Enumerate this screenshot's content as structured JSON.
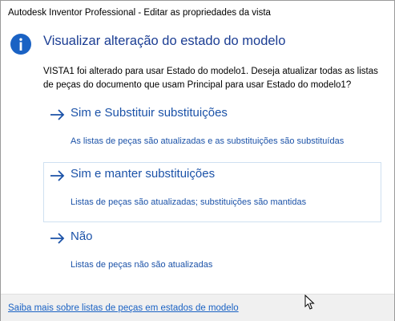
{
  "window": {
    "title": "Autodesk Inventor Professional - Editar as propriedades da vista"
  },
  "icon": {
    "name": "info-icon",
    "color": "#1a62c4"
  },
  "main_instruction": "Visualizar alteração do estado do modelo",
  "content": {
    "line1": "VISTA1 foi alterado para usar Estado do modelo1. Deseja atualizar todas as listas",
    "line2": "de peças do documento que usam Principal para usar Estado do modelo1?"
  },
  "options": [
    {
      "title": "Sim e Substituir substituições",
      "description": "As listas de peças são atualizadas e as substituições são substituídas"
    },
    {
      "title": "Sim e manter substituições",
      "description": "Listas de peças são atualizadas; substituições são mantidas"
    },
    {
      "title": "Não",
      "description": "Listas de peças não são atualizadas"
    }
  ],
  "footer": {
    "link": "Saiba mais sobre listas de peças em estados de modelo"
  },
  "colors": {
    "instruction": "#1b3d93",
    "link": "#1b52a8",
    "hover_border": "#cfe0f1",
    "footer_bg": "#f0f0f0"
  }
}
